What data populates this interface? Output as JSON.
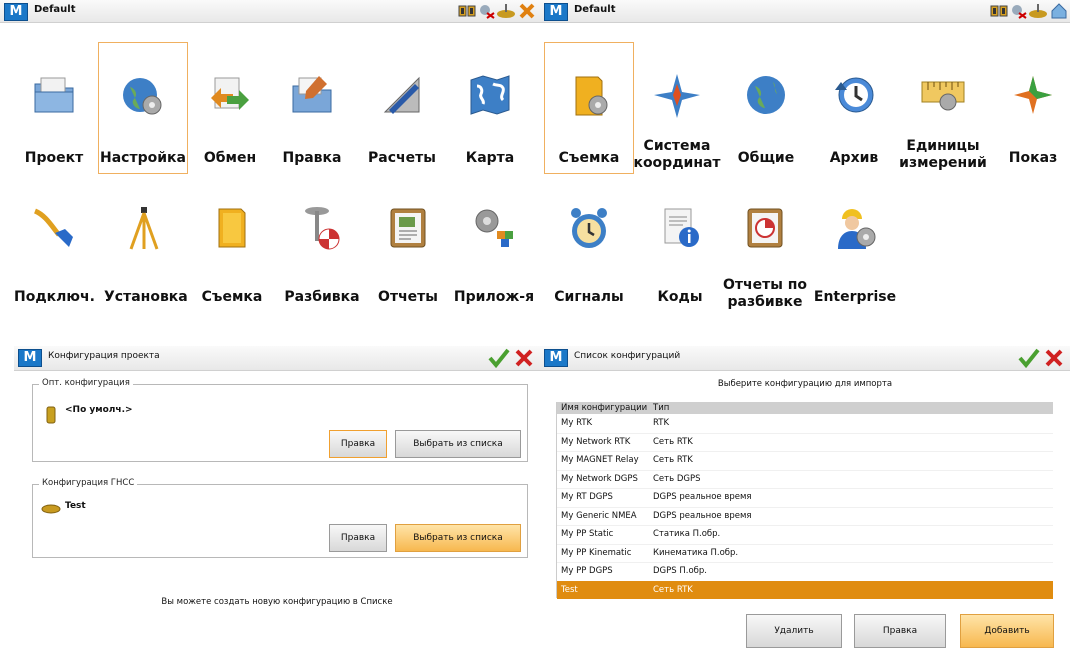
{
  "left_panel": {
    "title": "Default",
    "logo": "M",
    "tiles": [
      {
        "label": "Проект",
        "icon": "folder-icon"
      },
      {
        "label": "Настройка",
        "icon": "globe-gear-icon"
      },
      {
        "label": "Обмен",
        "icon": "exchange-icon"
      },
      {
        "label": "Правка",
        "icon": "folder-edit-icon"
      },
      {
        "label": "Расчеты",
        "icon": "calc-pencil-icon"
      },
      {
        "label": "Карта",
        "icon": "map-icon"
      }
    ],
    "tiles_row2": [
      {
        "label": "Подключ.",
        "icon": "cable-icon"
      },
      {
        "label": "Установка",
        "icon": "tripod-icon"
      },
      {
        "label": "Съемка",
        "icon": "folder-yellow-icon"
      },
      {
        "label": "Разбивка",
        "icon": "stake-icon"
      },
      {
        "label": "Отчеты",
        "icon": "report-icon"
      },
      {
        "label": "Прилож-я",
        "icon": "apps-gear-icon"
      }
    ]
  },
  "right_panel": {
    "title": "Default",
    "logo": "M",
    "tiles": [
      {
        "label": "Съемка",
        "icon": "folder-gear-icon"
      },
      {
        "label": "Система координат",
        "line1": "Система",
        "line2": "координат",
        "icon": "compass-icon"
      },
      {
        "label": "Общие",
        "icon": "globe-icon"
      },
      {
        "label": "Архив",
        "icon": "archive-icon"
      },
      {
        "label": "Единицы измерений",
        "line1": "Единицы",
        "line2": "измерений",
        "icon": "ruler-gear-icon"
      },
      {
        "label": "Показ",
        "icon": "star-icon"
      }
    ],
    "tiles_row2": [
      {
        "label": "Сигналы",
        "icon": "alarm-clock-icon"
      },
      {
        "label": "Коды",
        "icon": "info-doc-icon"
      },
      {
        "label": "Отчеты по разбивке",
        "line1": "Отчеты по",
        "line2": "разбивке",
        "icon": "stake-report-icon"
      },
      {
        "label": "Enterprise",
        "icon": "worker-gear-icon"
      }
    ]
  },
  "config_dialog": {
    "title": "Конфигурация проекта",
    "logo": "M",
    "opt_group": {
      "legend": "Опт. конфигурация",
      "value": "<По умолч.>",
      "edit": "Правка",
      "choose": "Выбрать из списка"
    },
    "gnss_group": {
      "legend": "Конфигурация ГНСС",
      "value": "Test",
      "edit": "Правка",
      "choose": "Выбрать из списка"
    },
    "note": "Вы можете создать новую конфигурацию в Списке"
  },
  "list_dialog": {
    "title": "Список конфигураций",
    "logo": "M",
    "subtitle": "Выберите конфигурацию для импорта",
    "columns": [
      "Имя конфигурации",
      "Тип"
    ],
    "rows": [
      [
        "My RTK",
        "RTK"
      ],
      [
        "My Network RTK",
        "Сеть RTK"
      ],
      [
        "My MAGNET Relay",
        "Сеть RTK"
      ],
      [
        "My Network DGPS",
        "Сеть DGPS"
      ],
      [
        "My RT DGPS",
        "DGPS реальное время"
      ],
      [
        "My Generic NMEA",
        "DGPS реальное время"
      ],
      [
        "My PP Static",
        "Статика П.обр."
      ],
      [
        "My PP Kinematic",
        "Кинематика П.обр."
      ],
      [
        "My PP DGPS",
        "DGPS П.обр."
      ],
      [
        "Test",
        "Сеть RTK"
      ]
    ],
    "selected_row": 9,
    "buttons": {
      "delete": "Удалить",
      "edit": "Правка",
      "add": "Добавить"
    }
  },
  "colors": {
    "accent_orange": "#e08c10",
    "brand_blue": "#1b78c8",
    "highlight_border": "#f0b060"
  }
}
